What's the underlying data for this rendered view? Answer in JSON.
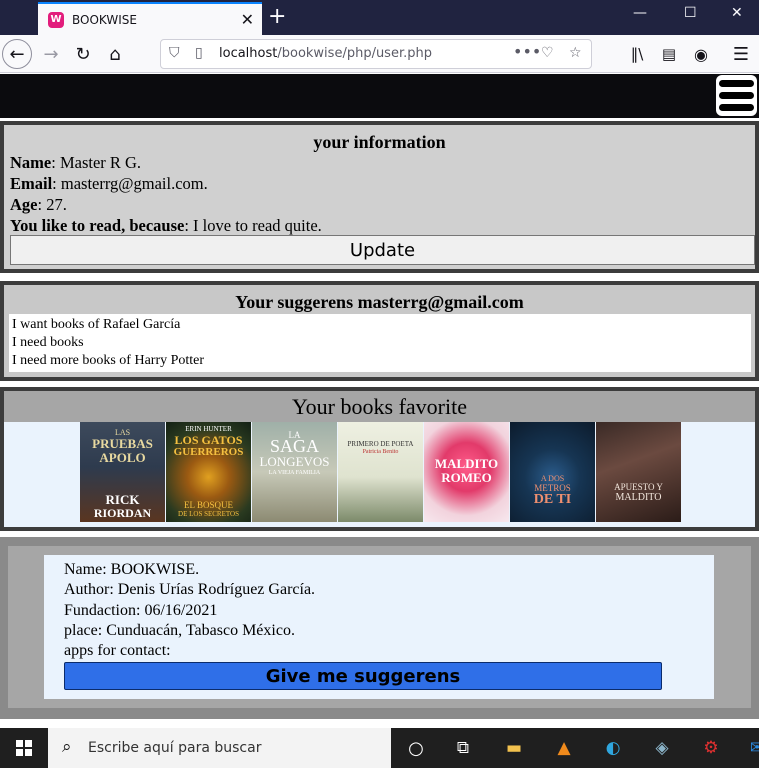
{
  "browser": {
    "tab_title": "BOOKWISE",
    "tab_favicon": "W",
    "url_host": "localhost",
    "url_path": "/bookwise/php/user.php"
  },
  "info": {
    "title": "your information",
    "name_label": "Name",
    "name_value": ": Master R G.",
    "email_label": "Email",
    "email_value": ": masterrg@gmail.com.",
    "age_label": "Age",
    "age_value": ": 27.",
    "reason_label": "You like to read, because",
    "reason_value": ": I love to read quite.",
    "update_label": "Update"
  },
  "suggestions": {
    "title": "Your suggerens masterrg@gmail.com",
    "items": [
      "I want books of Rafael García",
      "I need books",
      "I need more books of Harry Potter"
    ]
  },
  "favorites": {
    "title": "Your books favorite",
    "books": [
      {
        "l1": "LAS",
        "l2": "PRUEBAS",
        "l3": "APOLO",
        "l4": "RICK",
        "l5": "RIORDAN"
      },
      {
        "l1": "ERIN HUNTER",
        "l2": "LOS GATOS",
        "l3": "GUERREROS",
        "l4": "EL BOSQUE",
        "l5": "DE LOS SECRETOS"
      },
      {
        "l1": "LA",
        "l2": "SAGA",
        "l3": "LONGEVOS",
        "l4": "LA VIEJA FAMILIA",
        "l5": ""
      },
      {
        "l1": "PRIMERO DE POETA",
        "l2": "Patricia Benito",
        "l3": "",
        "l4": "",
        "l5": ""
      },
      {
        "l1": "MALDITO",
        "l2": "ROMEO",
        "l3": "",
        "l4": "",
        "l5": ""
      },
      {
        "l1": "A DOS",
        "l2": "METROS",
        "l3": "DE TI",
        "l4": "",
        "l5": ""
      },
      {
        "l1": "APUESTO Y",
        "l2": "MALDITO",
        "l3": "",
        "l4": "",
        "l5": ""
      }
    ]
  },
  "about": {
    "name": "Name: BOOKWISE.",
    "author": "Author: Denis Urías Rodríguez García.",
    "fundaction": "Fundaction: 06/16/2021",
    "place": "place: Cunduacán, Tabasco México.",
    "apps": "apps for contact:",
    "button_label": "Give me suggerens"
  },
  "taskbar": {
    "search_placeholder": "Escribe aquí para buscar"
  },
  "colors": {
    "header": "#0b0b0e",
    "panel_gray": "#d0d0d0",
    "border_dark": "#3c3c3c",
    "light_blue": "#eaf3fd",
    "button_blue": "#2f6fe8"
  }
}
